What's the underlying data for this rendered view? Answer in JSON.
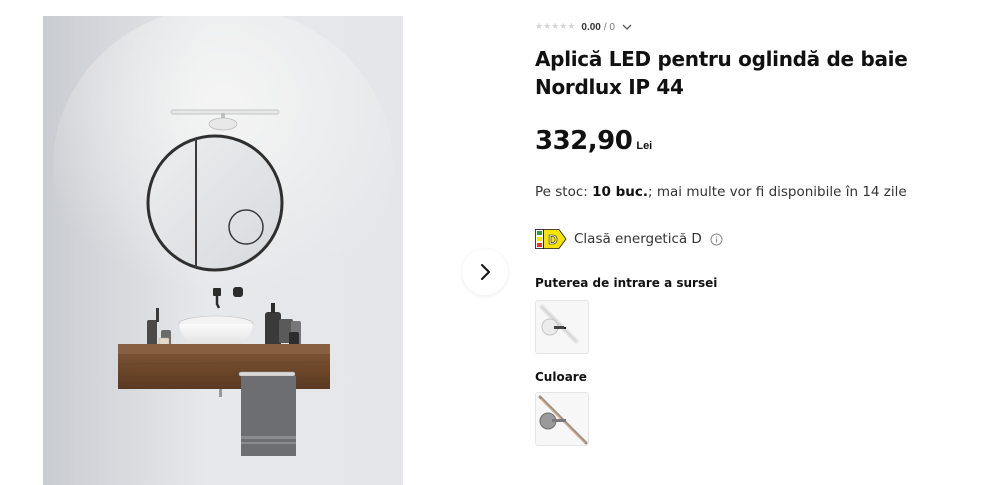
{
  "product": {
    "rating": {
      "stars_filled": 0,
      "stars_total": 5,
      "score": "0.00",
      "count_text": "/ 0"
    },
    "title_line1": "Aplică LED pentru oglindă de baie",
    "title_line2": "Nordlux IP 44",
    "price": {
      "value": "332,90",
      "currency": "Lei"
    },
    "stock": {
      "prefix": "Pe stoc:",
      "quantity": "10 buc.",
      "suffix": "; mai multe vor fi disponibile în 14 zile"
    },
    "energy": {
      "class_letter": "D",
      "label": "Clasă energetică D",
      "badge_color": "#f6e400"
    },
    "variants": {
      "power_label": "Puterea de intrare a sursei",
      "color_label": "Culoare"
    }
  },
  "icons": {
    "next": "chevron-right-icon",
    "rating_toggle": "chevron-down-icon",
    "info": "info-icon"
  }
}
